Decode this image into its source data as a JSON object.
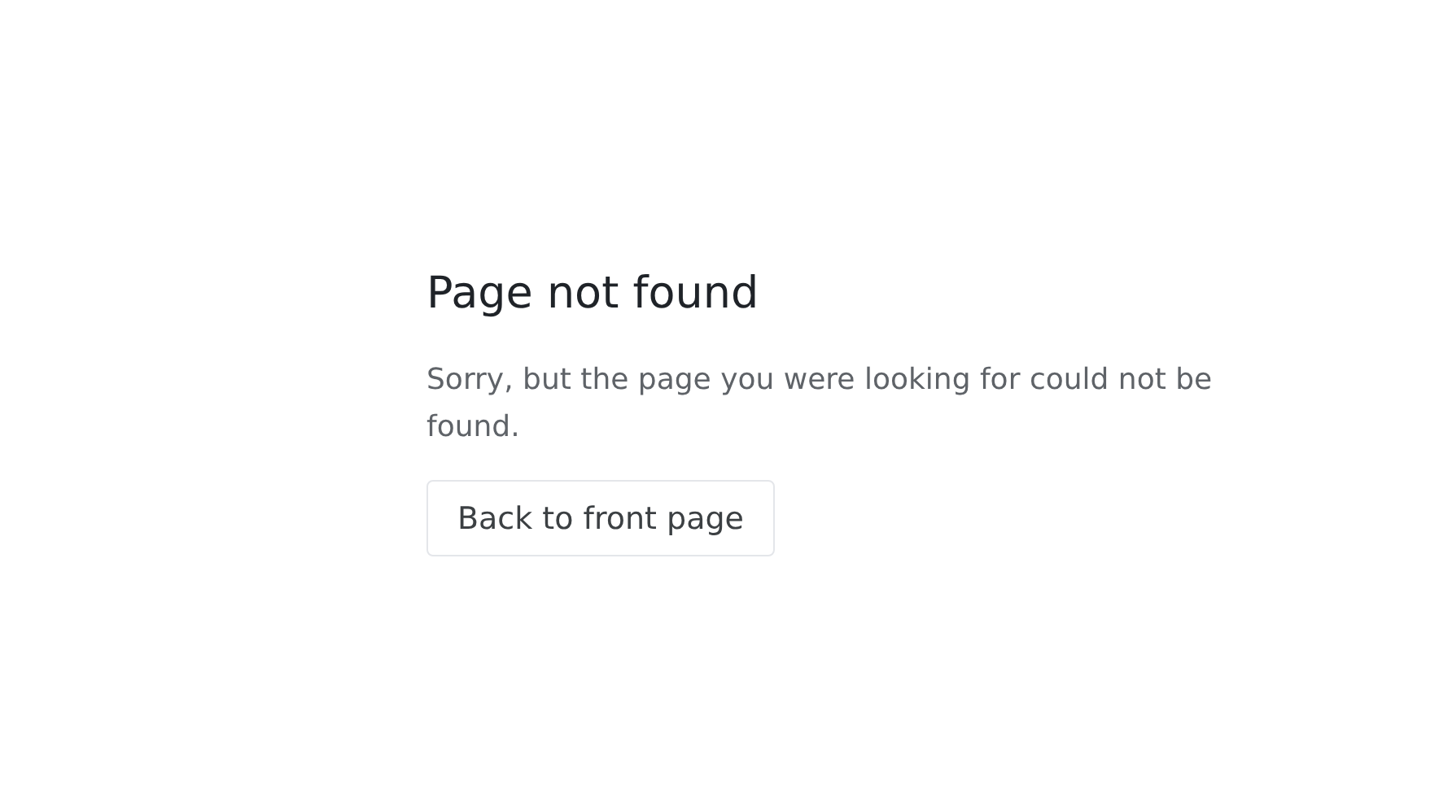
{
  "heading": "Page not found",
  "message": "Sorry, but the page you were looking for could not be found.",
  "button": {
    "label": "Back to front page"
  }
}
